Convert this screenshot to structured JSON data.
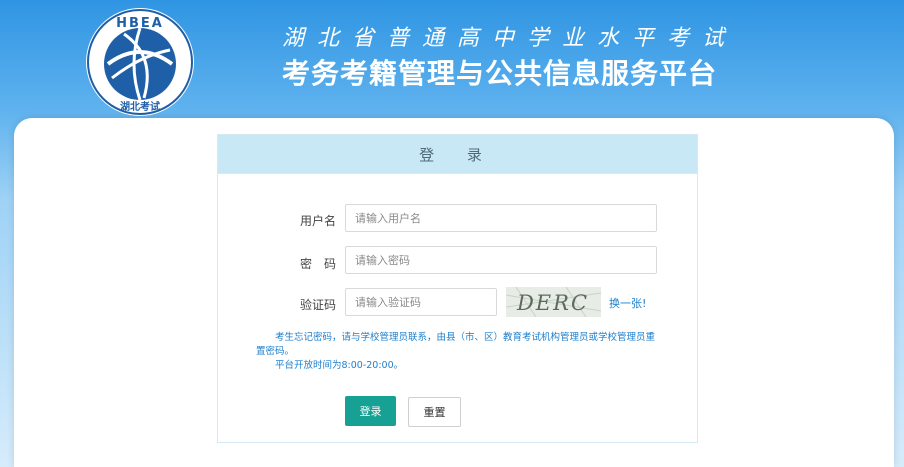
{
  "header": {
    "logo_text_top": "HBEA",
    "logo_text_bottom": "湖北考试",
    "title_line1": "湖北省普通高中学业水平考试",
    "title_line2": "考务考籍管理与公共信息服务平台"
  },
  "login": {
    "heading": "登 录",
    "username_label": "用户名",
    "username_placeholder": "请输入用户名",
    "password_label": "密　码",
    "password_placeholder": "请输入密码",
    "captcha_label": "验证码",
    "captcha_placeholder": "请输入验证码",
    "captcha_text": "DERC",
    "refresh_label": "换一张!",
    "notice_line1": "　　考生忘记密码，请与学校管理员联系，由县（市、区）教育考试机构管理员或学校管理员重置密码。",
    "notice_line2": "　　平台开放时间为8:00-20:00。",
    "login_button": "登录",
    "reset_button": "重置"
  },
  "colors": {
    "banner_blue": "#2f95e3",
    "panel_header": "#c7e8f4",
    "login_button": "#16a194",
    "link_blue": "#1e7fcc"
  }
}
